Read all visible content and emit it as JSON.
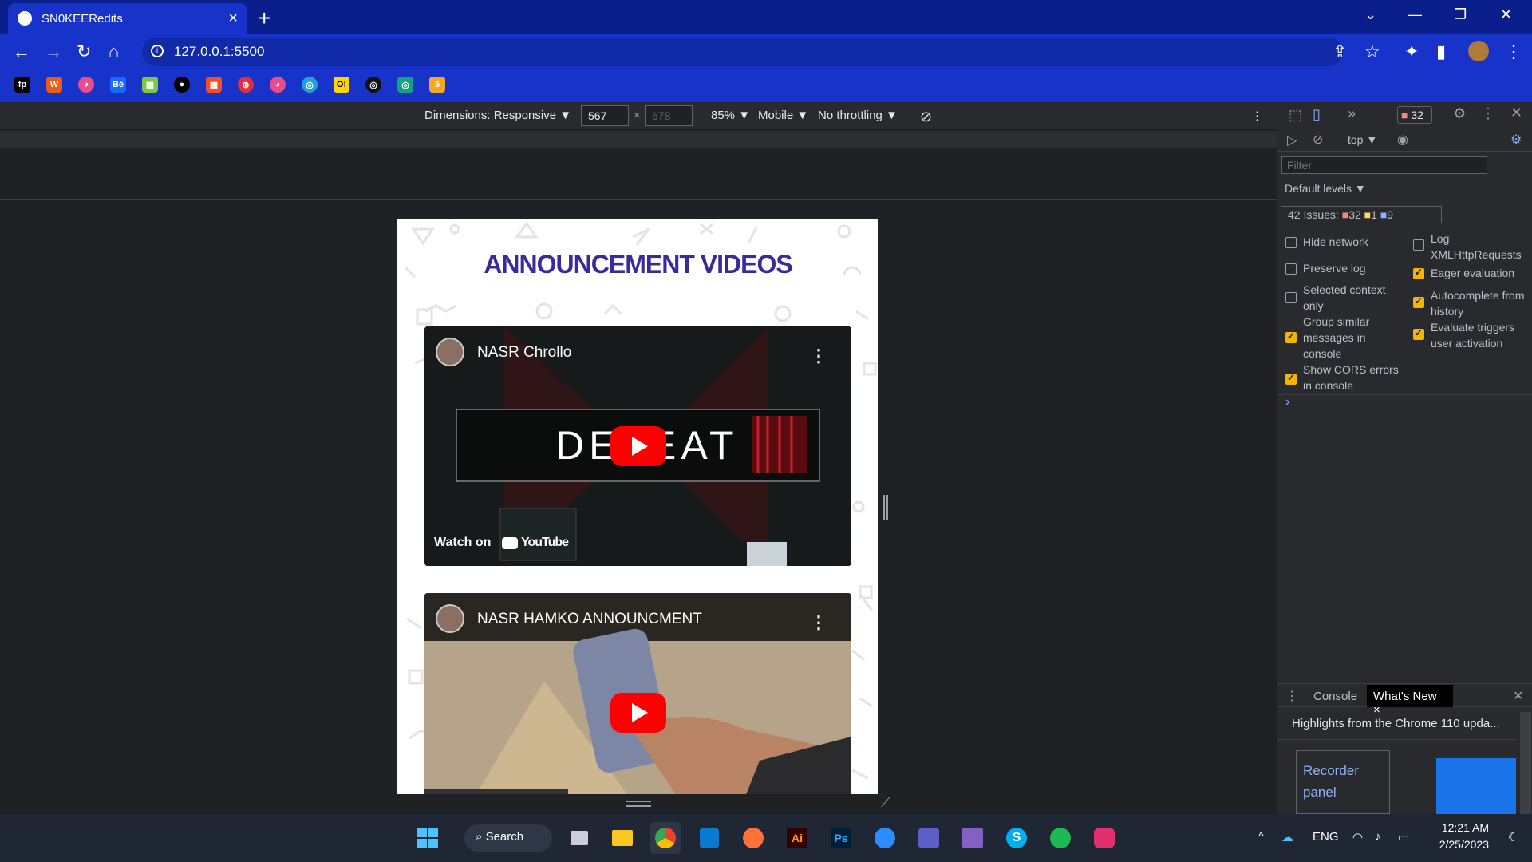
{
  "browser": {
    "tab_title": "SN0KEERedits",
    "tab_close": "×",
    "new_tab": "+",
    "url": "127.0.0.1:5500",
    "window_controls": [
      "⌄",
      "—",
      "❐",
      "✕"
    ]
  },
  "bookmarks": [
    "fp",
    "W",
    "◕",
    "Bē",
    "▦",
    "●",
    "▦",
    "⊕",
    "◕",
    "◎",
    "O!",
    "◎",
    "◎",
    "5"
  ],
  "device_toolbar": {
    "dimensions": "Dimensions: Responsive ▼",
    "width": "567",
    "height": "678",
    "times": "×",
    "zoom": "85% ▼",
    "mode": "Mobile ▼",
    "throttle": "No throttling ▼"
  },
  "page": {
    "heading": "ANNOUNCEMENT VIDEOS",
    "videos": [
      {
        "title": "NASR Chrollo",
        "overlay_text": "DEFEAT",
        "watch_on": "Watch on",
        "brand": "YouTube"
      },
      {
        "title": "NASR HAMKO ANNOUNCMENT"
      }
    ]
  },
  "devtools": {
    "issues_count_badge": "32",
    "context": "top ▼",
    "filter_placeholder": "Filter",
    "levels": "Default levels ▼",
    "issues_label": "42 Issues:",
    "issues_error": "32",
    "issues_warn": "1",
    "issues_info": "9",
    "settings_left": [
      {
        "label": "Hide network",
        "checked": false
      },
      {
        "label": "Preserve log",
        "checked": false
      },
      {
        "label": "Selected context only",
        "checked": false
      },
      {
        "label": "Group similar messages in console",
        "checked": true
      },
      {
        "label": "Show CORS errors in console",
        "checked": true
      }
    ],
    "settings_right": [
      {
        "label": "Log XMLHttpRequests",
        "checked": false
      },
      {
        "label": "Eager evaluation",
        "checked": true
      },
      {
        "label": "Autocomplete from history",
        "checked": true
      },
      {
        "label": "Evaluate triggers user activation",
        "checked": true
      }
    ],
    "prompt": "›",
    "drawer_tabs": [
      "Console",
      "What's New"
    ],
    "drawer_close": "×",
    "highlights": "Highlights from the Chrome 110 upda...",
    "recorder_line1": "Recorder",
    "recorder_line2": "panel"
  },
  "taskbar": {
    "search": "Search",
    "language": "ENG",
    "time": "12:21 AM",
    "date": "2/25/2023"
  },
  "colors": {
    "tab_bg": "#0a1e8c",
    "toolbar_bg": "#1733c9",
    "heading": "#3b2a9c",
    "youtube_red": "#ff0000",
    "checkbox_on": "#f4b400"
  }
}
